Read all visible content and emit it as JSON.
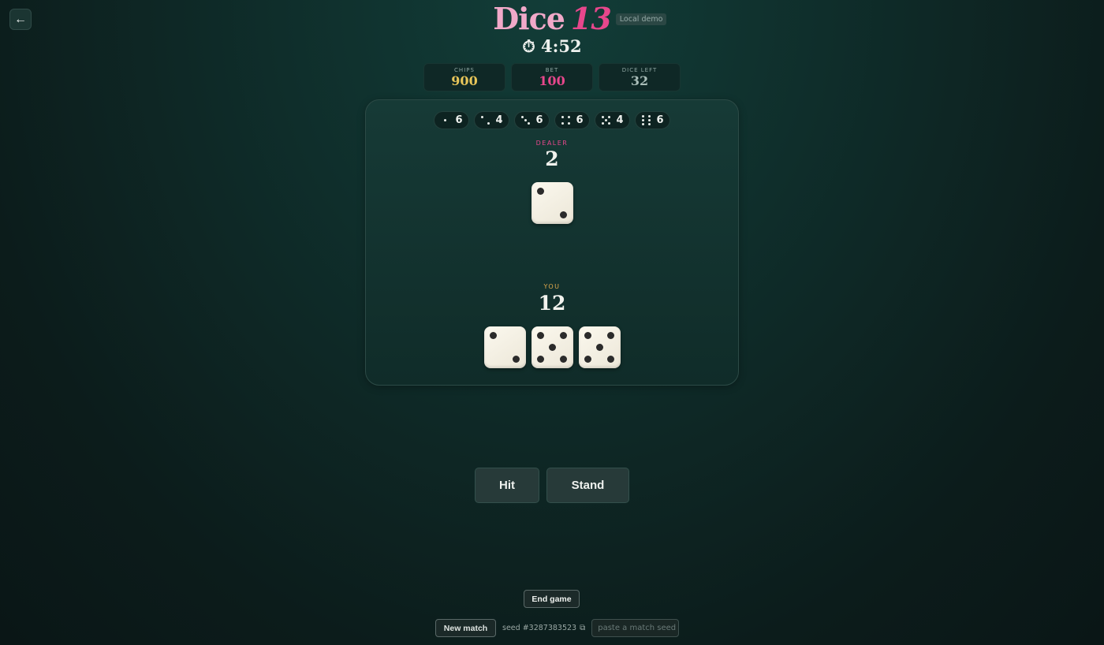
{
  "nav": {
    "back_icon": "arrow-left-icon",
    "back_glyph": "←"
  },
  "header": {
    "title_word": "Dice",
    "title_number": "13",
    "badge": "Local demo",
    "timer": "⏱ 4:52"
  },
  "stats": [
    {
      "label": "CHIPS",
      "value": "900",
      "color": "#e8c65a"
    },
    {
      "label": "BET",
      "value": "100",
      "color": "#e7478c"
    },
    {
      "label": "DICE LEFT",
      "value": "32",
      "color": "#a9bdb8"
    }
  ],
  "dice_counts": [
    {
      "face": 1,
      "count": "6"
    },
    {
      "face": 2,
      "count": "4"
    },
    {
      "face": 3,
      "count": "6"
    },
    {
      "face": 4,
      "count": "6"
    },
    {
      "face": 5,
      "count": "4"
    },
    {
      "face": 6,
      "count": "6"
    }
  ],
  "dealer": {
    "label": "DEALER",
    "label_color": "#e7478c",
    "total": "2",
    "dice": [
      2
    ]
  },
  "player": {
    "label": "YOU",
    "label_color": "#e0a94d",
    "total": "12",
    "dice": [
      2,
      5,
      5
    ]
  },
  "actions": {
    "hit": "Hit",
    "stand": "Stand",
    "end_game": "End game"
  },
  "footer": {
    "new_match": "New match",
    "seed_text": "seed #3287383523",
    "copy_icon": "copy-icon",
    "copy_glyph": "⧉",
    "seed_placeholder": "paste a match seed"
  }
}
